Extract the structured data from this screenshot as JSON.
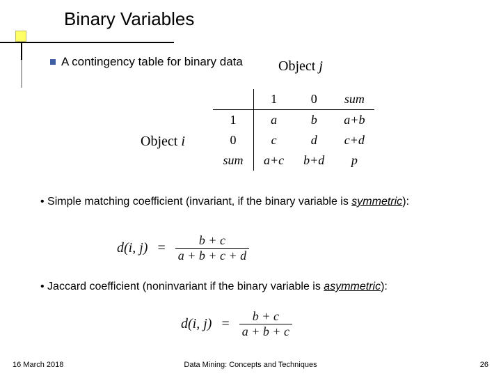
{
  "slide": {
    "title": "Binary Variables",
    "bullet_contingency": "A contingency table for binary data",
    "object_j": "Object  j",
    "object_i": "Object i",
    "smc_text_lead": "• Simple matching coefficient (invariant, if the binary variable is ",
    "smc_text_em": "symmetric",
    "smc_text_tail": "):",
    "jaccard_text_lead": "• Jaccard coefficient (noninvariant if the binary variable is ",
    "jaccard_text_em": "asymmetric",
    "jaccard_text_tail": "):"
  },
  "table": {
    "col1": "1",
    "col0": "0",
    "colsum": "sum",
    "row1": "1",
    "row0": "0",
    "rowsum": "sum",
    "a": "a",
    "b": "b",
    "ab": "a+b",
    "c": "c",
    "d": "d",
    "cd": "c+d",
    "ac": "a+c",
    "bd": "b+d",
    "p": "p"
  },
  "formula_smc": {
    "lhs": "d(i, j)",
    "eq": "=",
    "num": "b + c",
    "den": "a + b + c + d"
  },
  "formula_jaccard": {
    "lhs": "d(i, j)",
    "eq": "=",
    "num": "b + c",
    "den": "a + b + c"
  },
  "footer": {
    "date": "16 March 2018",
    "center": "Data Mining: Concepts and Techniques",
    "page": "26"
  },
  "chart_data": {
    "type": "table",
    "title": "Contingency table for binary data (Object i rows vs Object j columns)",
    "columns": [
      "",
      "1",
      "0",
      "sum"
    ],
    "rows": [
      [
        "1",
        "a",
        "b",
        "a+b"
      ],
      [
        "0",
        "c",
        "d",
        "c+d"
      ],
      [
        "sum",
        "a+c",
        "b+d",
        "p"
      ]
    ]
  }
}
